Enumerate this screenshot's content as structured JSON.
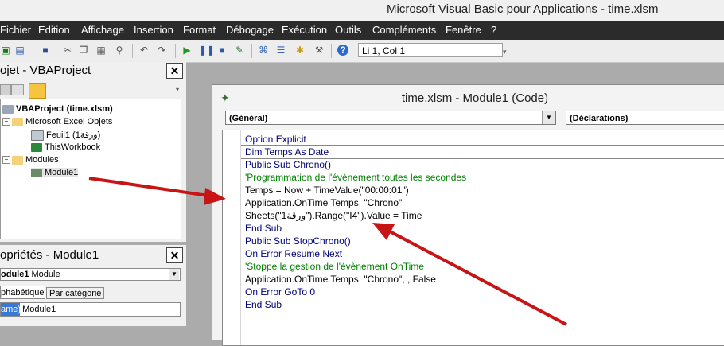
{
  "window_title": "Microsoft Visual Basic pour Applications - time.xlsm",
  "menu": [
    "Fichier",
    "Edition",
    "Affichage",
    "Insertion",
    "Format",
    "Débogage",
    "Exécution",
    "Outils",
    "Compléments",
    "Fenêtre",
    "?"
  ],
  "toolbar": {
    "position": "Li 1, Col 1"
  },
  "project": {
    "title": "ojet - VBAProject",
    "root": "VBAProject (time.xlsm)",
    "folder_objects": "Microsoft Excel Objets",
    "sheet": "Feuil1 (ورقة1)",
    "workbook": "ThisWorkbook",
    "folder_modules": "Modules",
    "module": "Module1"
  },
  "properties": {
    "title": "opriétés - Module1",
    "object": "odule1",
    "object_type": "Module",
    "tab_alpha": "phabétique",
    "tab_cat": "Par catégorie",
    "prop_name": "ame)",
    "prop_value": "Module1"
  },
  "code_window": {
    "title": "time.xlsm - Module1 (Code)",
    "dropdown_left": "(Général)",
    "dropdown_right": "(Déclarations)",
    "lines": [
      "Option Explicit",
      "Dim Temps As Date",
      "Public Sub Chrono()",
      "'Programmation de l'évènement toutes les secondes",
      "Temps = Now + TimeValue(\"00:00:01\")",
      "Application.OnTime Temps, \"Chrono\"",
      "Sheets(\"ورقة1\").Range(\"I4\").Value = Time",
      "End Sub",
      "Public Sub StopChrono()",
      "On Error Resume Next",
      "'Stoppe la gestion de l'évènement OnTime",
      "Application.OnTime Temps, \"Chrono\", , False",
      "On Error GoTo 0",
      "End Sub"
    ]
  },
  "colors": {
    "keyword": "#00007a",
    "comment": "#008000",
    "arrow": "#c81414"
  }
}
